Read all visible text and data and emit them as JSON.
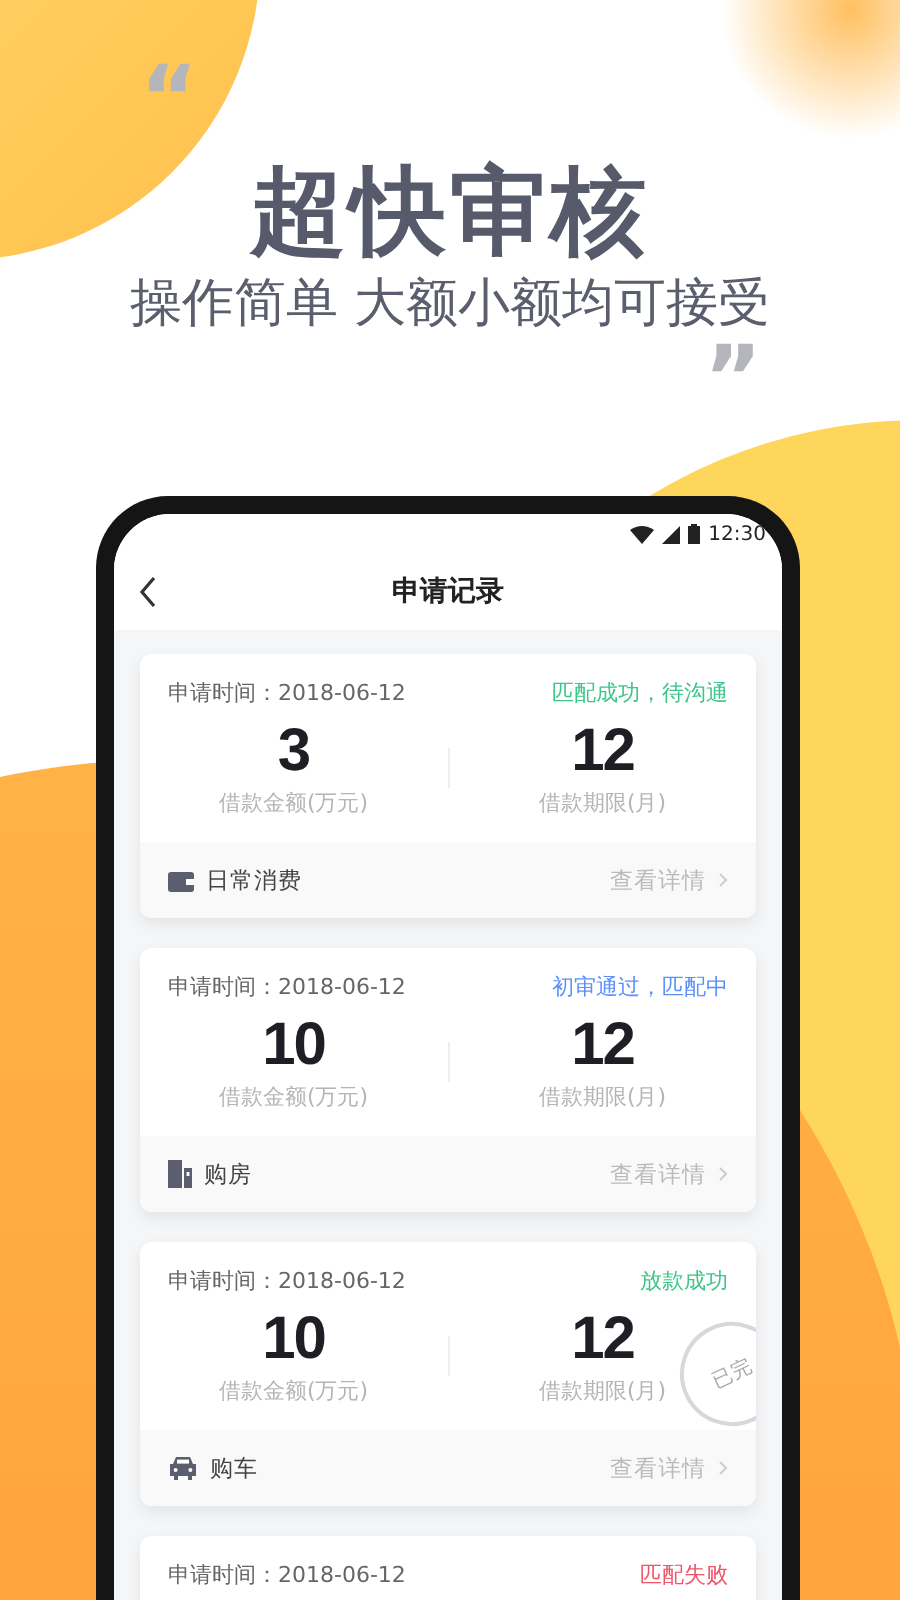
{
  "promo": {
    "open_quote": "“",
    "title": "超快审核",
    "subtitle": "操作简单 大额小额均可接受",
    "close_quote": "”"
  },
  "status_bar": {
    "time": "12:30"
  },
  "nav": {
    "title": "申请记录"
  },
  "records": [
    {
      "date": "申请时间：2018-06-12",
      "status": "匹配成功，待沟通",
      "color": "#3ec58a",
      "amount": "3",
      "amount_label": "借款金额(万元)",
      "term": "12",
      "term_label": "借款期限(月)",
      "kind": "wallet",
      "purpose": "日常消费",
      "detail": "查看详情"
    },
    {
      "date": "申请时间：2018-06-12",
      "status": "初审通过，匹配中",
      "color": "#5b8ff9",
      "amount": "10",
      "amount_label": "借款金额(万元)",
      "term": "12",
      "term_label": "借款期限(月)",
      "kind": "house",
      "purpose": "购房",
      "detail": "查看详情"
    },
    {
      "date": "申请时间：2018-06-12",
      "status": "放款成功",
      "color": "#3ec58a",
      "amount": "10",
      "amount_label": "借款金额(万元)",
      "term": "12",
      "term_label": "借款期限(月)",
      "stamp": "已完",
      "kind": "car",
      "purpose": "购车",
      "detail": "查看详情"
    },
    {
      "date": "申请时间：2018-06-12",
      "status": "匹配失败",
      "color": "#f0546a"
    }
  ]
}
